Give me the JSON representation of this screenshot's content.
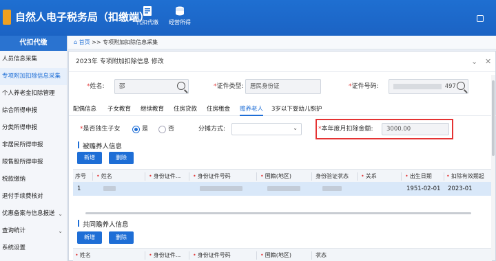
{
  "header": {
    "app_title": "自然人电子税务局（扣缴端）",
    "buttons": [
      {
        "label": "代扣代缴",
        "icon": "report-icon"
      },
      {
        "label": "经营所得",
        "icon": "coins-icon"
      }
    ]
  },
  "sidebar": {
    "title": "代扣代缴",
    "items": [
      {
        "label": "人员信息采集",
        "has_arrow": false
      },
      {
        "label": "专项附加扣除信息采集",
        "has_arrow": false
      },
      {
        "label": "个人养老金扣除管理",
        "has_arrow": false
      },
      {
        "label": "综合所得申报",
        "has_arrow": false
      },
      {
        "label": "分类所得申报",
        "has_arrow": false
      },
      {
        "label": "非居民所得申报",
        "has_arrow": false
      },
      {
        "label": "限售股所得申报",
        "has_arrow": false
      },
      {
        "label": "税款缴纳",
        "has_arrow": false
      },
      {
        "label": "退付手续费核对",
        "has_arrow": false
      },
      {
        "label": "优惠备案与信息报送",
        "has_arrow": true
      },
      {
        "label": "查询统计",
        "has_arrow": true
      },
      {
        "label": "系统设置",
        "has_arrow": false
      }
    ],
    "active_index": 1
  },
  "breadcrumb": {
    "home": "首页",
    "separator": ">>",
    "current": "专项附加扣除信息采集"
  },
  "modal": {
    "title": "2023年 专项附加扣除信息 修改",
    "name_label": "姓名:",
    "name_value": "邵",
    "id_type_label": "证件类型:",
    "id_type_value": "居民身份证",
    "id_number_label": "证件号码:",
    "id_number_suffix": "497",
    "tabs": [
      "配偶信息",
      "子女教育",
      "继续教育",
      "住房贷款",
      "住房租金",
      "赡养老人",
      "3岁以下婴幼儿照护"
    ],
    "active_tab": 5,
    "only_child_label": "是否独生子女",
    "yes_label": "是",
    "no_label": "否",
    "only_child_selected": "是",
    "split_label": "分摊方式:",
    "split_value": "",
    "monthly_label": "本年度月扣除金额:",
    "monthly_value": "3000.00",
    "supported_title": "被赡养人信息",
    "add_label": "新增",
    "delete_label": "删除",
    "table1_headers": [
      "序号",
      "姓名",
      "身份证件...",
      "身份证件号码",
      "国籍(地区)",
      "身份验证状态",
      "关系",
      "出生日期",
      "扣除有效期起"
    ],
    "table1_row": {
      "index": "1",
      "birth": "1951-02-01",
      "start": "2023-01"
    },
    "co_title": "共同赡养人信息",
    "table2_headers": [
      "姓名",
      "身份证件...",
      "身份证件号码",
      "国籍(地区)",
      "状态"
    ]
  },
  "colors": {
    "primary": "#1e6ed6",
    "highlight_border": "#e53333",
    "selected_row": "#d9e8f9"
  }
}
